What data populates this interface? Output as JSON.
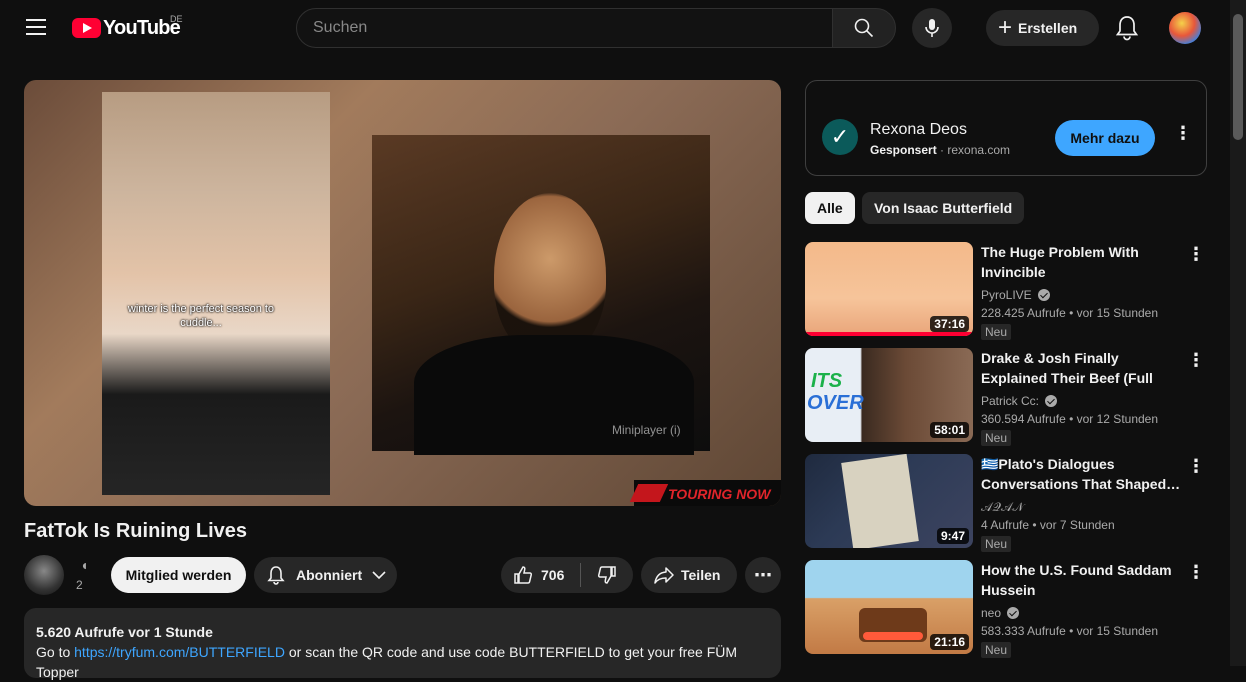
{
  "header": {
    "logo_text": "YouTube",
    "country_code": "DE",
    "search_placeholder": "Suchen",
    "create_label": "Erstellen"
  },
  "video": {
    "caption": "winter is the perfect season to cuddle...",
    "miniplayer_label": "Miniplayer (i)",
    "banner_text": "TOURING NOW",
    "title": "FatTok Is Ruining Lives"
  },
  "channel": {
    "name": "◖",
    "subscribers": "2",
    "join_label": "Mitglied werden",
    "subscribed_label": "Abonniert"
  },
  "actions": {
    "like_count": "706",
    "share_label": "Teilen",
    "more_label": "⋯"
  },
  "description": {
    "stats": "5.620 Aufrufe  vor 1 Stunde",
    "text_before": "Go to ",
    "link": "https://tryfum.com/BUTTERFIELD",
    "text_after": " or scan the QR code and use code BUTTERFIELD to get your free FÜM Topper"
  },
  "ad": {
    "logo_char": "✓",
    "name": "Rexona Deos",
    "sponsored": "Gesponsert",
    "domain": "rexona.com",
    "cta": "Mehr dazu",
    "more": "⋮"
  },
  "chips": {
    "all": "Alle",
    "channel": "Von Isaac Butterfield"
  },
  "recommendations": [
    {
      "title": "The Huge Problem With Invincible",
      "channel": "PyroLIVE",
      "verified": true,
      "views": "228.425 Aufrufe",
      "age": "vor 15 Stunden",
      "badge": "Neu",
      "duration": "37:16",
      "more": "⋮"
    },
    {
      "title": "Drake & Josh Finally Explained Their Beef (Full Documentary)",
      "channel": "Patrick Cc:",
      "verified": true,
      "views": "360.594 Aufrufe",
      "age": "vor 12 Stunden",
      "badge": "Neu",
      "duration": "58:01",
      "more": "⋮",
      "thumb_text_1": "ITS",
      "thumb_text_2": "OVER"
    },
    {
      "title": "🇬🇷Plato's Dialogues Conversations That Shaped…",
      "channel": "𝒜𝒬𝒜𝒩",
      "verified": false,
      "views": "4 Aufrufe",
      "age": "vor 7 Stunden",
      "badge": "Neu",
      "duration": "9:47",
      "more": "⋮"
    },
    {
      "title": "How the U.S. Found Saddam Hussein",
      "channel": "neo",
      "verified": true,
      "views": "583.333 Aufrufe",
      "age": "vor 15 Stunden",
      "badge": "Neu",
      "duration": "21:16",
      "more": "⋮"
    }
  ]
}
